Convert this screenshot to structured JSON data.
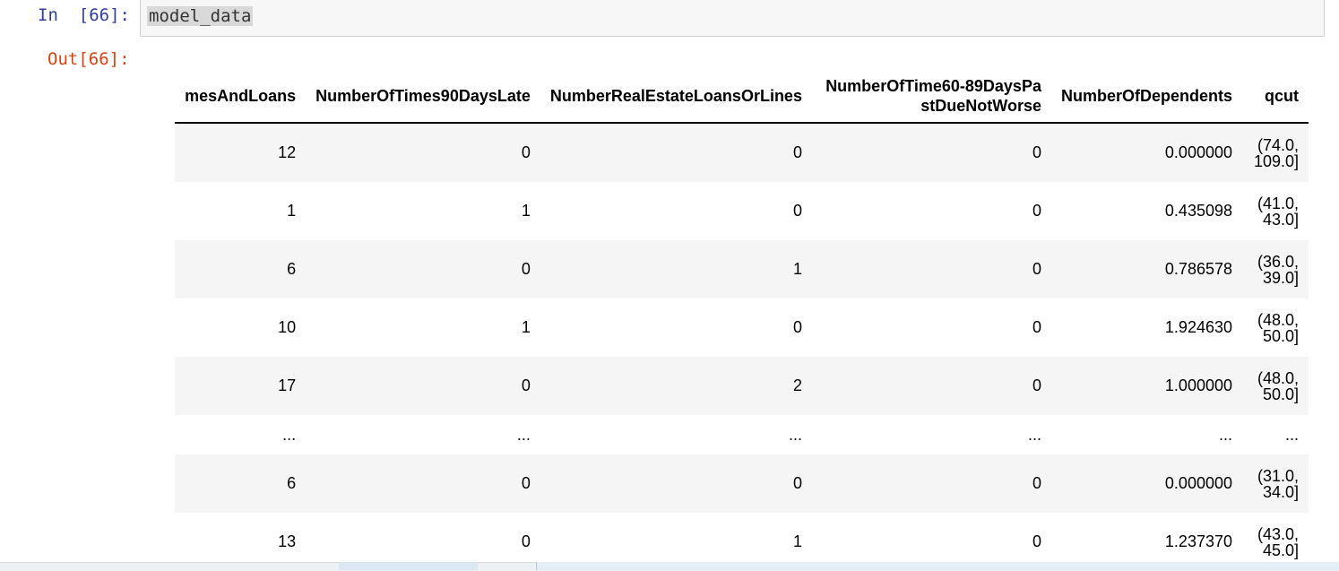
{
  "cell": {
    "in_prompt": "In  [66]:",
    "code": "model_data",
    "out_prompt": "Out[66]:"
  },
  "table": {
    "columns": [
      "mesAndLoans",
      "NumberOfTimes90DaysLate",
      "NumberRealEstateLoansOrLines",
      "NumberOfTime60-89DaysPastDueNotWorse",
      "NumberOfDependents",
      "qcut"
    ],
    "rows": [
      [
        "12",
        "0",
        "0",
        "0",
        "0.000000",
        "(74.0, 109.0]"
      ],
      [
        "1",
        "1",
        "0",
        "0",
        "0.435098",
        "(41.0, 43.0]"
      ],
      [
        "6",
        "0",
        "1",
        "0",
        "0.786578",
        "(36.0, 39.0]"
      ],
      [
        "10",
        "1",
        "0",
        "0",
        "1.924630",
        "(48.0, 50.0]"
      ],
      [
        "17",
        "0",
        "2",
        "0",
        "1.000000",
        "(48.0, 50.0]"
      ],
      [
        "...",
        "...",
        "...",
        "...",
        "...",
        "..."
      ],
      [
        "6",
        "0",
        "0",
        "0",
        "0.000000",
        "(31.0, 34.0]"
      ],
      [
        "13",
        "0",
        "1",
        "0",
        "1.237370",
        "(43.0, 45.0]"
      ]
    ]
  }
}
